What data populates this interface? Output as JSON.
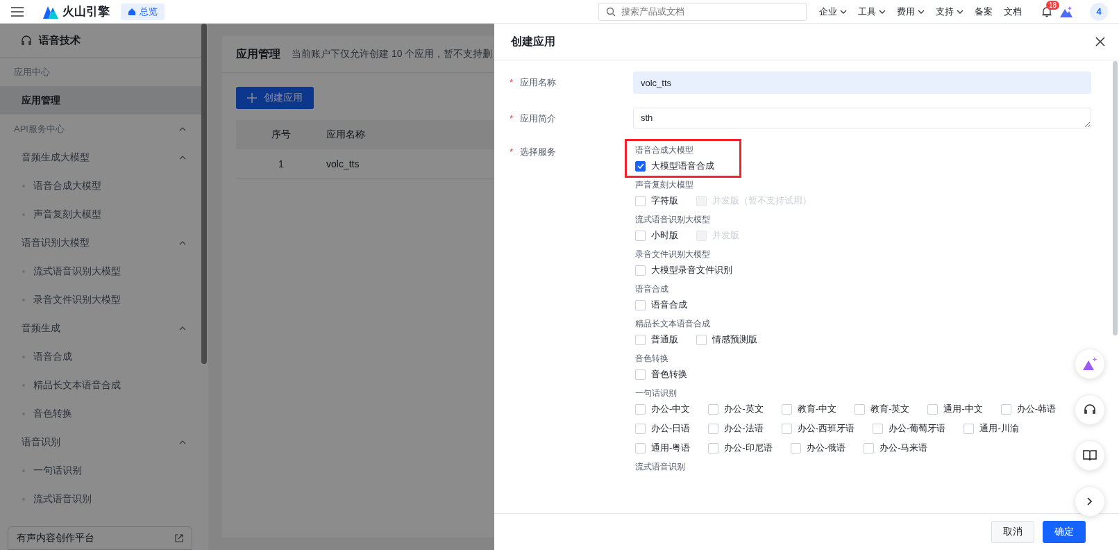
{
  "topbar": {
    "brand": "火山引擎",
    "tab": {
      "label": "总览",
      "selected": true
    },
    "search": {
      "placeholder": "搜索产品或文档"
    },
    "nav": [
      {
        "label": "企业",
        "dropdown": true
      },
      {
        "label": "工具",
        "dropdown": true
      },
      {
        "label": "费用",
        "dropdown": true
      },
      {
        "label": "支持",
        "dropdown": true
      },
      {
        "label": "备案",
        "dropdown": false
      },
      {
        "label": "文档",
        "dropdown": false
      }
    ],
    "notifications": "18",
    "avatar": "4"
  },
  "sidebar": {
    "title": "语音技术",
    "sections": [
      {
        "label": "应用中心",
        "children": [
          {
            "label": "应用管理",
            "selected": true
          }
        ]
      },
      {
        "label": "API服务中心",
        "expanded": true,
        "children": [
          {
            "label": "音频生成大模型",
            "expanded": true,
            "children": [
              {
                "label": "语音合成大模型",
                "selected": false
              },
              {
                "label": "声音复刻大模型",
                "selected": false
              }
            ]
          },
          {
            "label": "语音识别大模型",
            "expanded": true,
            "children": [
              {
                "label": "流式语音识别大模型",
                "selected": false
              },
              {
                "label": "录音文件识别大模型",
                "selected": false
              }
            ]
          },
          {
            "label": "音频生成",
            "expanded": true,
            "children": [
              {
                "label": "语音合成",
                "selected": false
              },
              {
                "label": "精品长文本语音合成",
                "selected": false
              },
              {
                "label": "音色转换",
                "selected": false
              }
            ]
          },
          {
            "label": "语音识别",
            "expanded": true,
            "children": [
              {
                "label": "一句话识别",
                "selected": false
              },
              {
                "label": "流式语音识别",
                "selected": false
              }
            ]
          }
        ]
      }
    ],
    "footer_link": "有声内容创作平台"
  },
  "main": {
    "title": "应用管理",
    "notice": "当前账户下仅允许创建 10 个应用，暂不支持删",
    "create_button": "创建应用",
    "table": {
      "columns": [
        "序号",
        "应用名称"
      ],
      "rows": [
        [
          "1",
          "volc_tts"
        ]
      ]
    }
  },
  "drawer": {
    "title": "创建应用",
    "fields": [
      {
        "label": "应用名称",
        "marker": "*",
        "kind": "input",
        "value": "volc_tts"
      },
      {
        "label": "应用简介",
        "marker": "*",
        "kind": "textarea",
        "value": "sth"
      }
    ],
    "services": {
      "label": "选择服务",
      "marker": "*",
      "groups": [
        {
          "title": "语音合成大模型",
          "highlighted": true,
          "options": [
            {
              "label": "大模型语音合成",
              "checked": true,
              "disabled": false
            }
          ]
        },
        {
          "title": "声音复刻大模型",
          "highlighted": false,
          "options": [
            {
              "label": "字符版",
              "checked": false,
              "disabled": false
            },
            {
              "label": "并发版（暂不支持试用）",
              "checked": false,
              "disabled": true
            }
          ]
        },
        {
          "title": "流式语音识别大模型",
          "highlighted": false,
          "options": [
            {
              "label": "小时版",
              "checked": false,
              "disabled": false
            },
            {
              "label": "并发版",
              "checked": false,
              "disabled": true
            }
          ]
        },
        {
          "title": "录音文件识别大模型",
          "highlighted": false,
          "options": [
            {
              "label": "大模型录音文件识别",
              "checked": false,
              "disabled": false
            }
          ]
        },
        {
          "title": "语音合成",
          "highlighted": false,
          "options": [
            {
              "label": "语音合成",
              "checked": false,
              "disabled": false
            }
          ]
        },
        {
          "title": "精品长文本语音合成",
          "highlighted": false,
          "options": [
            {
              "label": "普通版",
              "checked": false,
              "disabled": false
            },
            {
              "label": "情感预测版",
              "checked": false,
              "disabled": false
            }
          ]
        },
        {
          "title": "音色转换",
          "highlighted": false,
          "options": [
            {
              "label": "音色转换",
              "checked": false,
              "disabled": false
            }
          ]
        },
        {
          "title": "一句话识别",
          "highlighted": false,
          "options": [
            {
              "label": "办公-中文",
              "checked": false,
              "disabled": false
            },
            {
              "label": "办公-英文",
              "checked": false,
              "disabled": false
            },
            {
              "label": "教育-中文",
              "checked": false,
              "disabled": false
            },
            {
              "label": "教育-英文",
              "checked": false,
              "disabled": false
            },
            {
              "label": "通用-中文",
              "checked": false,
              "disabled": false
            },
            {
              "label": "办公-韩语",
              "checked": false,
              "disabled": false
            },
            {
              "label": "办公-日语",
              "checked": false,
              "disabled": false
            },
            {
              "label": "办公-法语",
              "checked": false,
              "disabled": false
            },
            {
              "label": "办公-西班牙语",
              "checked": false,
              "disabled": false
            },
            {
              "label": "办公-葡萄牙语",
              "checked": false,
              "disabled": false
            },
            {
              "label": "通用-川渝",
              "checked": false,
              "disabled": false
            },
            {
              "label": "通用-粤语",
              "checked": false,
              "disabled": false
            },
            {
              "label": "办公-印尼语",
              "checked": false,
              "disabled": false
            },
            {
              "label": "办公-俄语",
              "checked": false,
              "disabled": false
            },
            {
              "label": "办公-马来语",
              "checked": false,
              "disabled": false
            }
          ]
        },
        {
          "title": "流式语音识别",
          "highlighted": false
        }
      ]
    }
  },
  "buttons": [
    {
      "label": "取消",
      "kind": "secondary"
    },
    {
      "label": "确定",
      "kind": "primary"
    }
  ]
}
